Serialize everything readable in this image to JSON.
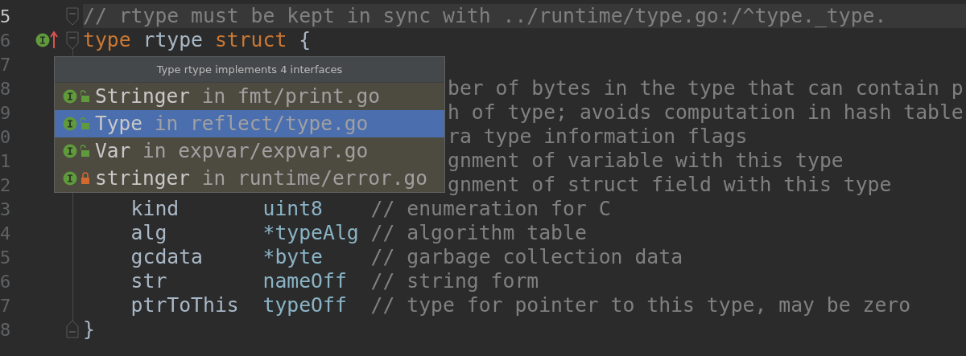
{
  "lines": [
    {
      "number": "5",
      "kind": "plain",
      "current": true,
      "marker": false,
      "fold_start": true,
      "fold_end": false,
      "segments": [
        {
          "kind": "comment",
          "text": "// rtype must be kept in sync with ../runtime/type.go:/^type._type."
        }
      ]
    },
    {
      "number": "6",
      "kind": "plain",
      "current": false,
      "marker": true,
      "fold_start": true,
      "fold_end": false,
      "segments": [
        {
          "kind": "keyword",
          "text": "type"
        },
        {
          "kind": "ident",
          "text": "rtype"
        },
        {
          "kind": "keyword",
          "text": "struct"
        },
        {
          "kind": "ident",
          "text": "{"
        }
      ]
    },
    {
      "number": "7",
      "kind": "covered",
      "current": false
    },
    {
      "number": "8",
      "kind": "covered",
      "current": false,
      "segments": [
        {
          "kind": "comment",
          "text": "ber of bytes in the type that can contain p"
        }
      ]
    },
    {
      "number": "9",
      "kind": "covered",
      "current": false,
      "segments": [
        {
          "kind": "comment",
          "text": "h of type; avoids computation in hash table"
        }
      ]
    },
    {
      "number": "0",
      "kind": "covered",
      "current": false,
      "segments": [
        {
          "kind": "comment",
          "text": "ra type information flags"
        }
      ]
    },
    {
      "number": "1",
      "kind": "covered",
      "current": false,
      "segments": [
        {
          "kind": "comment",
          "text": "gnment of variable with this type"
        }
      ]
    },
    {
      "number": "2",
      "kind": "covered",
      "current": false,
      "segments": [
        {
          "kind": "comment",
          "text": "gnment of struct field with this type"
        }
      ]
    },
    {
      "number": "3",
      "kind": "field",
      "current": false,
      "segments": [
        {
          "kind": "ident",
          "text": "kind"
        },
        {
          "kind": "type",
          "text": "uint8"
        },
        {
          "kind": "comment",
          "text": "// enumeration for C"
        }
      ]
    },
    {
      "number": "4",
      "kind": "field",
      "current": false,
      "segments": [
        {
          "kind": "ident",
          "text": "alg"
        },
        {
          "kind": "type",
          "text": "*typeAlg"
        },
        {
          "kind": "comment",
          "text": "// algorithm table"
        }
      ]
    },
    {
      "number": "5",
      "kind": "field",
      "current": false,
      "segments": [
        {
          "kind": "ident",
          "text": "gcdata"
        },
        {
          "kind": "type",
          "text": "*byte"
        },
        {
          "kind": "comment",
          "text": "// garbage collection data"
        }
      ]
    },
    {
      "number": "6",
      "kind": "field",
      "current": false,
      "segments": [
        {
          "kind": "ident",
          "text": "str"
        },
        {
          "kind": "type",
          "text": "nameOff"
        },
        {
          "kind": "comment",
          "text": "// string form"
        }
      ]
    },
    {
      "number": "7",
      "kind": "field",
      "current": false,
      "segments": [
        {
          "kind": "ident",
          "text": "ptrToThis"
        },
        {
          "kind": "type",
          "text": "typeOff"
        },
        {
          "kind": "comment",
          "text": "// type for pointer to this type, may be zero"
        }
      ]
    },
    {
      "number": "8",
      "kind": "plain",
      "current": false,
      "marker": false,
      "fold_start": false,
      "fold_end": true,
      "segments": [
        {
          "kind": "ident",
          "text": "}"
        }
      ]
    }
  ],
  "popup": {
    "title": "Type rtype implements 4 interfaces",
    "items": [
      {
        "name": "Stringer",
        "location": "in fmt/print.go",
        "private": false,
        "selected": false
      },
      {
        "name": "Type",
        "location": "in reflect/type.go",
        "private": false,
        "selected": true
      },
      {
        "name": "Var",
        "location": "in expvar/expvar.go",
        "private": false,
        "selected": false
      },
      {
        "name": "stringer",
        "location": "in runtime/error.go",
        "private": true,
        "selected": false
      }
    ]
  }
}
